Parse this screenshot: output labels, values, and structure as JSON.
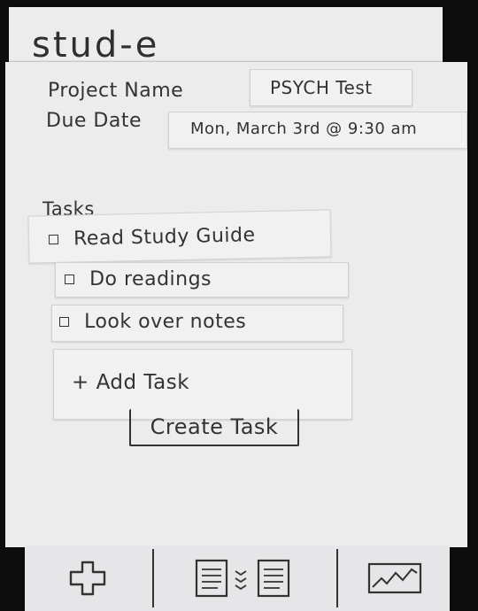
{
  "app": {
    "title": "stud-e"
  },
  "project": {
    "name_label": "Project Name",
    "name_value": "PSYCH Test",
    "due_label": "Due Date",
    "due_value": "Mon, March 3rd @ 9:30 am"
  },
  "tasks": {
    "heading": "Tasks",
    "items": [
      {
        "label": "Read Study Guide",
        "checked": false
      },
      {
        "label": "Do readings",
        "checked": false
      },
      {
        "label": "Look over notes",
        "checked": false
      }
    ],
    "add_label": "+ Add Task",
    "create_label": "Create Task"
  },
  "tabbar": {
    "tabs": [
      {
        "icon": "plus-icon"
      },
      {
        "icon": "documents-compare-icon"
      },
      {
        "icon": "chart-icon"
      }
    ]
  }
}
